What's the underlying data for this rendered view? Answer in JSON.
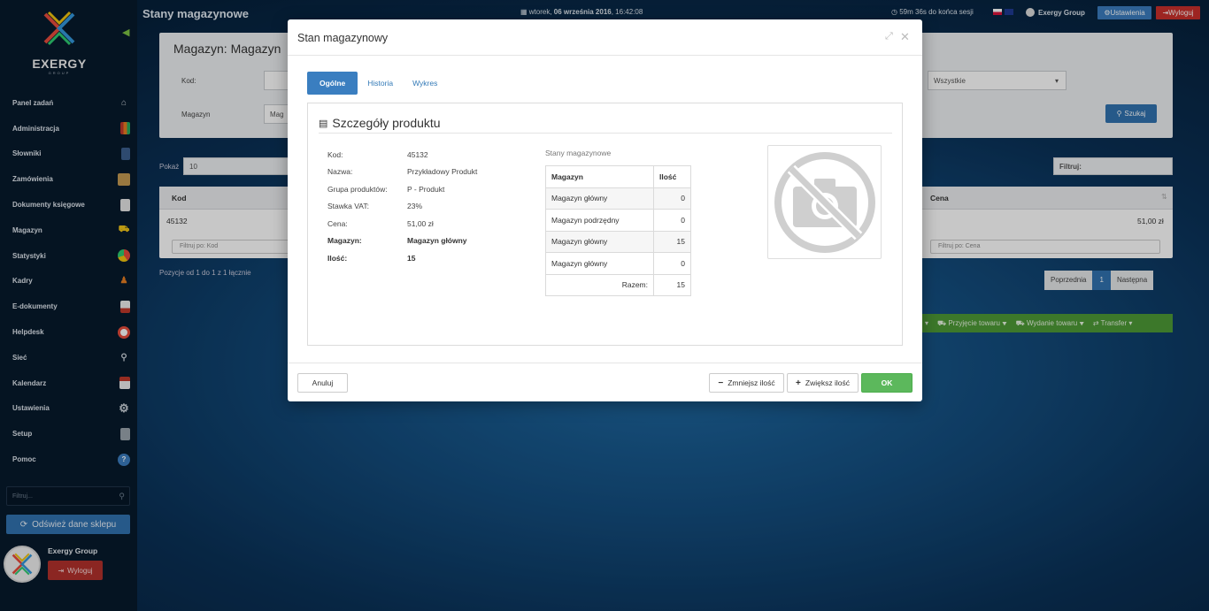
{
  "sidebar": {
    "logo_text": "EXERGY",
    "logo_sub": "GROUP",
    "items": [
      {
        "label": "Panel zadań",
        "icon": "home-icon"
      },
      {
        "label": "Administracja",
        "icon": "books-icon"
      },
      {
        "label": "Słowniki",
        "icon": "book-icon"
      },
      {
        "label": "Zamówienia",
        "icon": "box-icon"
      },
      {
        "label": "Dokumenty księgowe",
        "icon": "document-icon"
      },
      {
        "label": "Magazyn",
        "icon": "forklift-icon"
      },
      {
        "label": "Statystyki",
        "icon": "pie-chart-icon"
      },
      {
        "label": "Kadry",
        "icon": "person-icon"
      },
      {
        "label": "E-dokumenty",
        "icon": "pdf-icon"
      },
      {
        "label": "Helpdesk",
        "icon": "lifebuoy-icon"
      },
      {
        "label": "Sieć",
        "icon": "network-icon"
      },
      {
        "label": "Kalendarz",
        "icon": "calendar-icon"
      },
      {
        "label": "Ustawienia",
        "icon": "gear-icon"
      },
      {
        "label": "Setup",
        "icon": "setup-icon"
      },
      {
        "label": "Pomoc",
        "icon": "help-icon"
      }
    ],
    "filter_placeholder": "Filtruj...",
    "refresh_label": "Odśwież dane sklepu",
    "user_name": "Exergy Group",
    "logout_label": "Wyloguj"
  },
  "topbar": {
    "title": "Stany magazynowe",
    "date_prefix": "wtorek, ",
    "date_bold": "06 września 2016",
    "time": ", 16:42:08",
    "session": "59m 36s  do końca sesji",
    "company": "Exergy Group",
    "settings_label": "Ustawienia",
    "logout_label": "Wyloguj"
  },
  "background": {
    "panel_title": "Magazyn: Magazyn",
    "kod_label": "Kod:",
    "magazyn_label": "Magazyn",
    "magazyn_value": "Mag",
    "select_value": "Wszystkie",
    "search_label": "Szukaj",
    "page_size_label": "Pokaż",
    "page_size": "10",
    "filter_label": "Filtruj:",
    "col_kod": "Kod",
    "col_cena": "Cena",
    "row_kod": "45132",
    "row_cena": "51,00 zł",
    "filter_kod": "Filtruj po: Kod",
    "filter_cena": "Filtruj po: Cena",
    "info": "Pozycje od 1 do 1 z 1 łącznie",
    "prev_label": "Poprzednia",
    "page_num": "1",
    "next_label": "Następna",
    "action_przyjecie": "Przyjęcie towaru",
    "action_wydanie": "Wydanie towaru",
    "action_transfer": "Transfer"
  },
  "modal": {
    "title": "Stan magazynowy",
    "tabs": [
      "Ogólne",
      "Historia",
      "Wykres"
    ],
    "section_title": "Szczegóły produktu",
    "details": [
      {
        "label": "Kod:",
        "value": "45132"
      },
      {
        "label": "Nazwa:",
        "value": "Przykładowy Produkt"
      },
      {
        "label": "Grupa produktów:",
        "value": "P - Produkt"
      },
      {
        "label": "Stawka VAT:",
        "value": "23%"
      },
      {
        "label": "Cena:",
        "value": "51,00 zł"
      },
      {
        "label": "Magazyn:",
        "value": "Magazyn główny"
      },
      {
        "label": "Ilość:",
        "value": "15"
      }
    ],
    "stock_title": "Stany magazynowe",
    "stock_headers": [
      "Magazyn",
      "Ilość"
    ],
    "stock_rows": [
      {
        "name": "Magazyn główny",
        "qty": "0"
      },
      {
        "name": "Magazyn podrzędny",
        "qty": "0"
      },
      {
        "name": "Magazyn główny",
        "qty": "15"
      },
      {
        "name": "Magazyn główny",
        "qty": "0"
      }
    ],
    "total_label": "Razem:",
    "total_value": "15",
    "cancel_label": "Anuluj",
    "decrease_label": "Zmniejsz ilość",
    "increase_label": "Zwiększ ilość",
    "ok_label": "OK"
  }
}
